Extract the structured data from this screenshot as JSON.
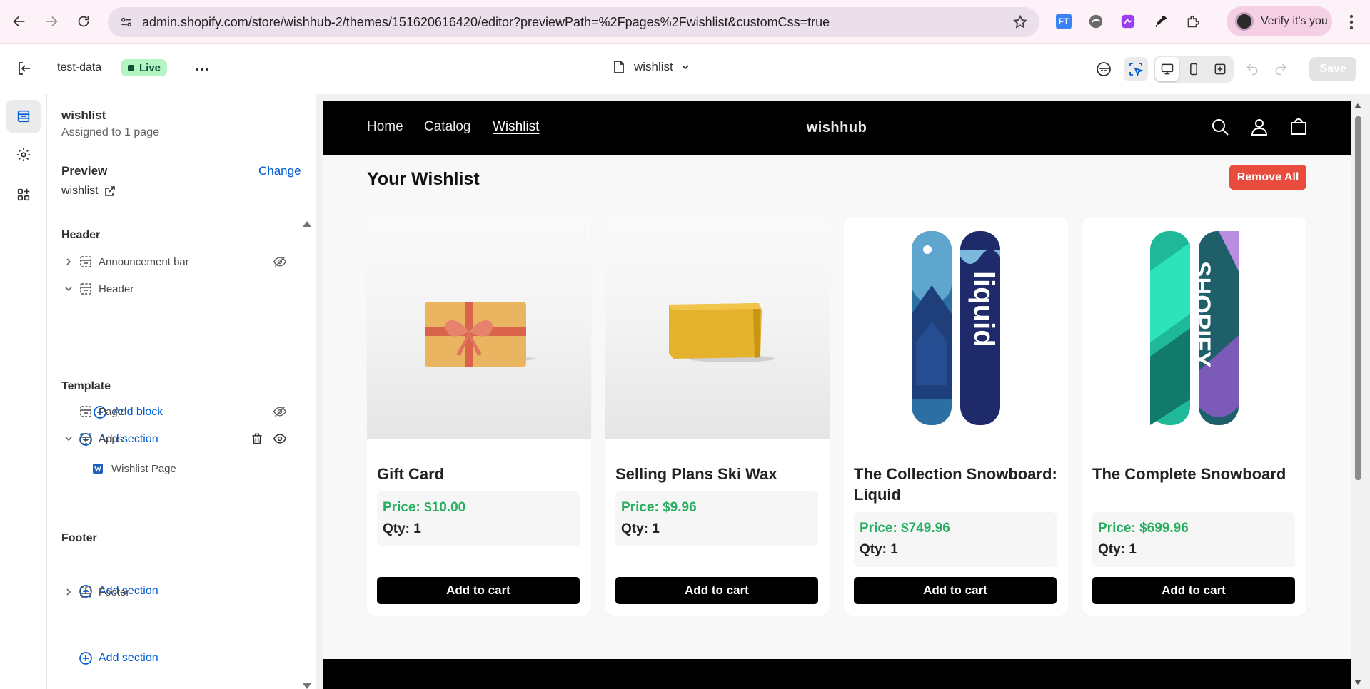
{
  "browser": {
    "url": "admin.shopify.com/store/wishhub-2/themes/151620616420/editor?previewPath=%2Fpages%2Fwishlist&customCss=true",
    "profile_label": "Verify it's you",
    "extension_icons": [
      "ft-extension-icon",
      "circle-extension-icon",
      "purple-extension-icon",
      "eyedropper-extension-icon",
      "puzzle-extension-icon"
    ]
  },
  "topbar": {
    "store_name": "test-data",
    "live_label": "Live",
    "template_name": "wishlist",
    "save_label": "Save"
  },
  "sidebar": {
    "template_title": "wishlist",
    "assigned": "Assigned to 1 page",
    "preview_label": "Preview",
    "change_label": "Change",
    "preview_page": "wishlist",
    "header_group": {
      "title": "Header",
      "announcement_bar": "Announcement bar",
      "header": "Header",
      "add_block": "Add block",
      "add_section": "Add section"
    },
    "template_group": {
      "title": "Template",
      "page": "Page",
      "apps": "Apps",
      "wishlist_page": "Wishlist Page",
      "add_section": "Add section"
    },
    "footer_group": {
      "title": "Footer",
      "add_section": "Add section",
      "footer": "Footer"
    }
  },
  "store": {
    "nav": [
      "Home",
      "Catalog",
      "Wishlist"
    ],
    "logo": "wishhub",
    "page_title": "Your Wishlist",
    "remove_all": "Remove All",
    "products": [
      {
        "name": "Gift Card",
        "price": "Price: $10.00",
        "qty": "Qty: 1",
        "button": "Add to cart"
      },
      {
        "name": "Selling Plans Ski Wax",
        "price": "Price: $9.96",
        "qty": "Qty: 1",
        "button": "Add to cart"
      },
      {
        "name": "The Collection Snowboard: Liquid",
        "price": "Price: $749.96",
        "qty": "Qty: 1",
        "button": "Add to cart"
      },
      {
        "name": "The Complete Snowboard",
        "price": "Price: $699.96",
        "qty": "Qty: 1",
        "button": "Add to cart"
      }
    ],
    "snowboard_lettering": [
      "liquid",
      "SHOPIFY"
    ]
  },
  "colors": {
    "accent_link": "#005bd3",
    "live_badge": "#b4f5c4",
    "remove_all": "#e74c3c",
    "price": "#27ae60",
    "store_header": "#000000"
  }
}
